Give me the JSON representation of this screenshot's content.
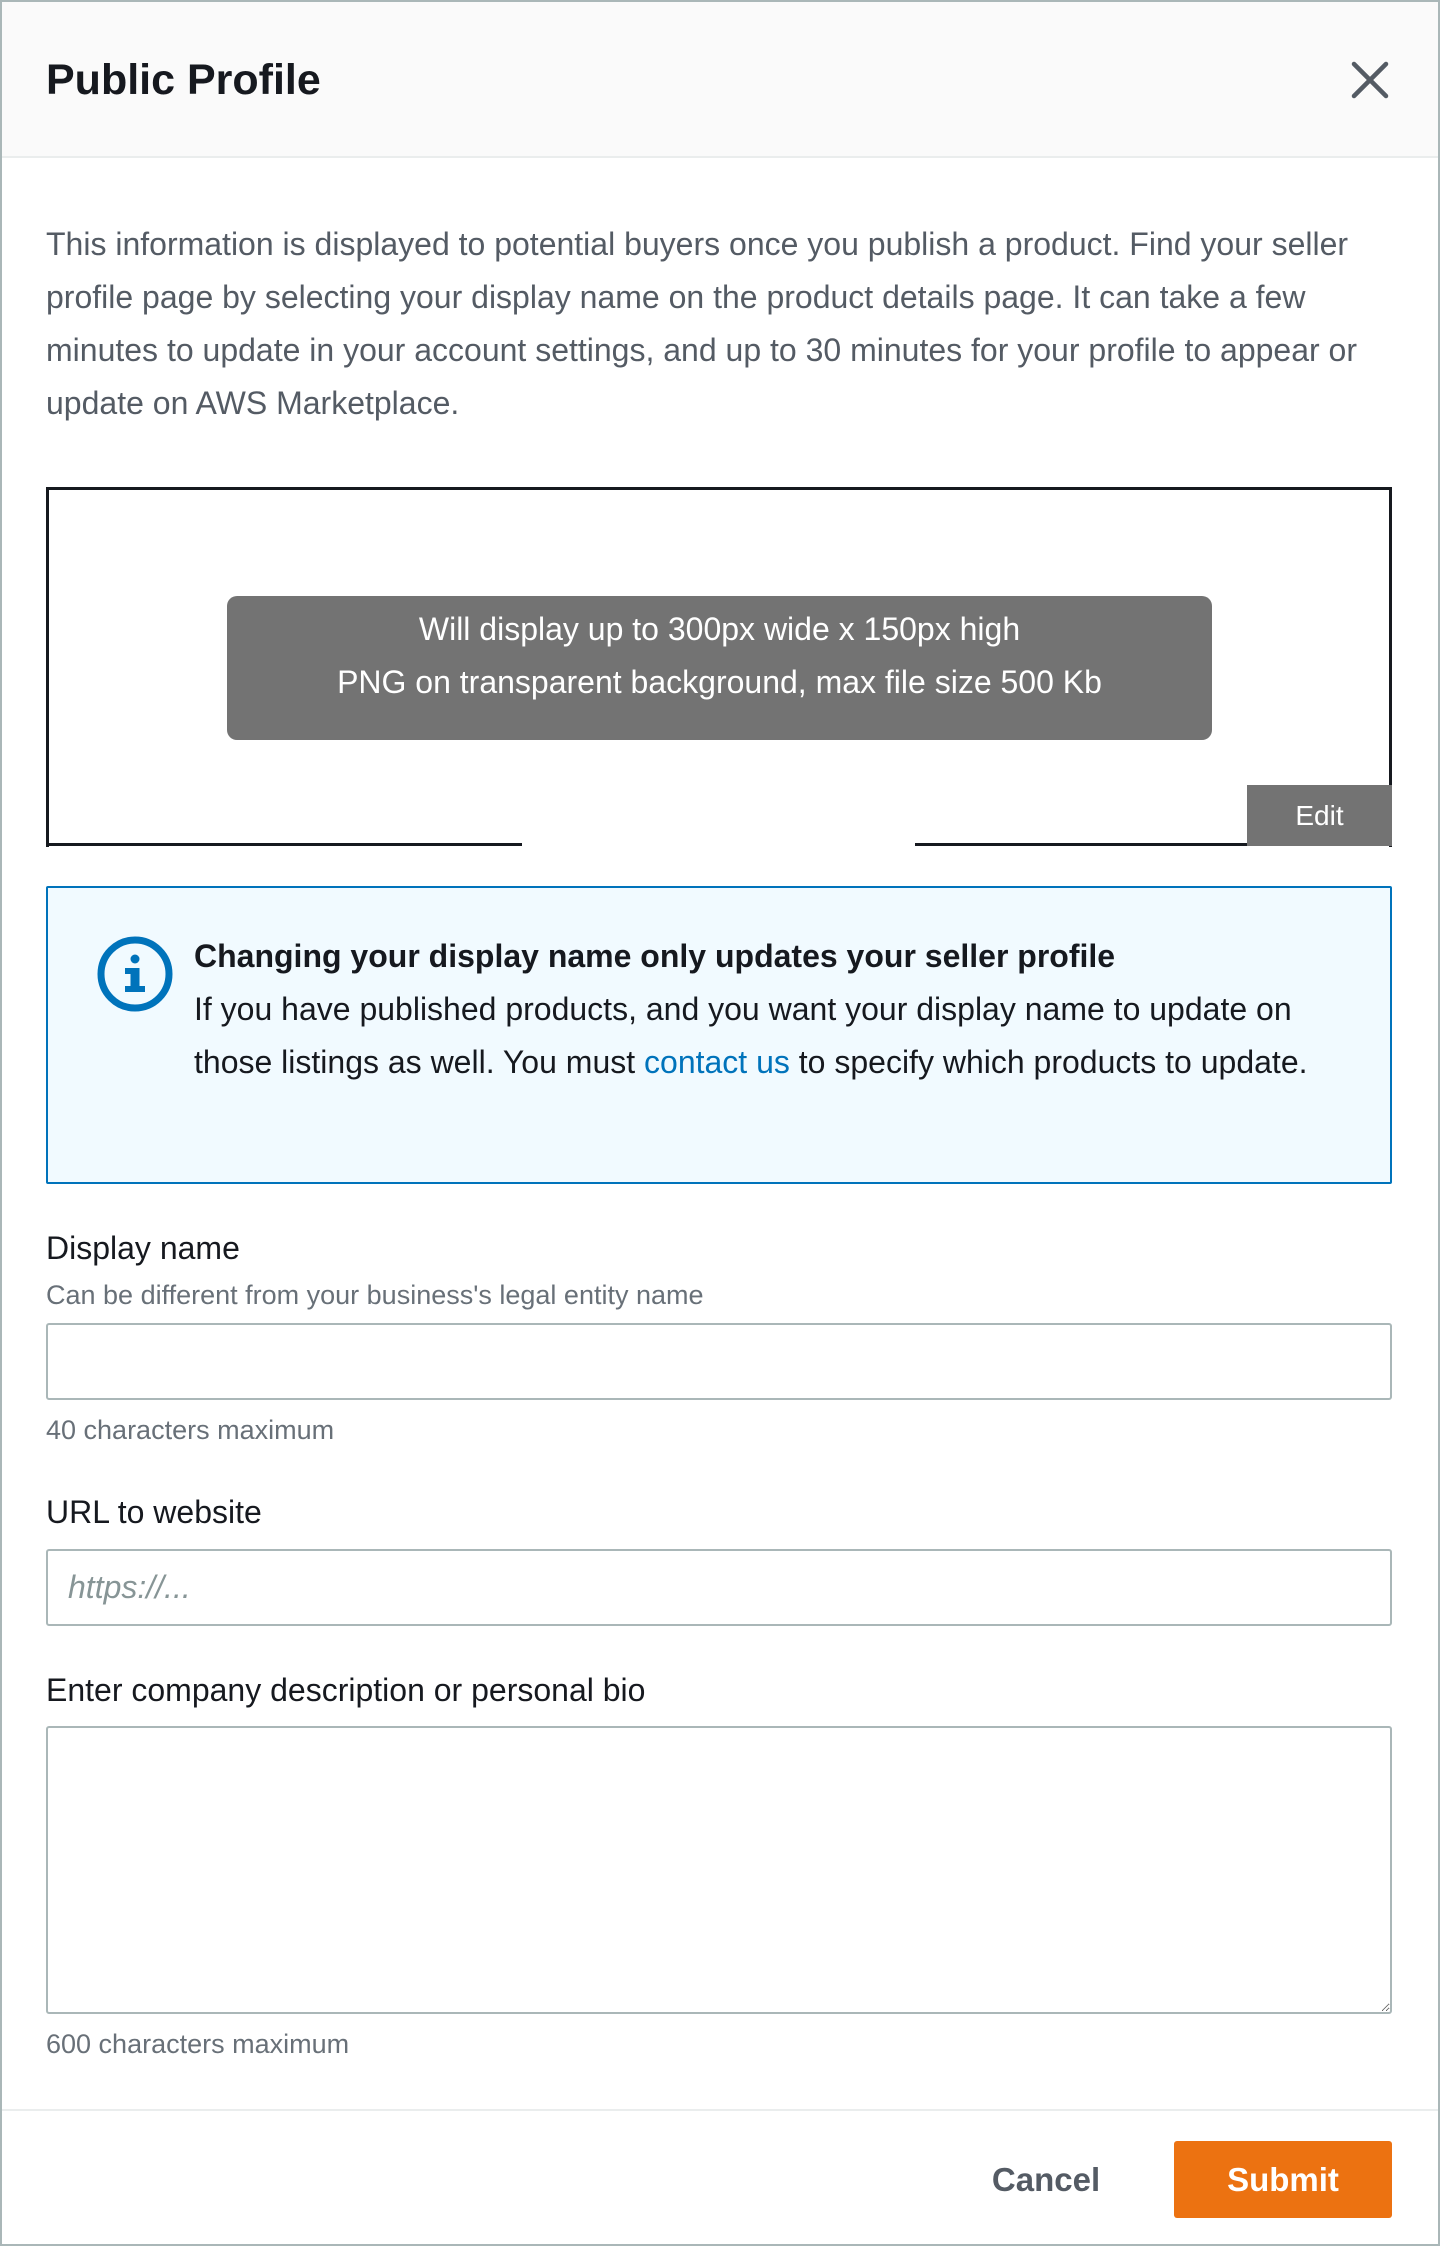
{
  "modal": {
    "title": "Public Profile",
    "close_icon": "close-icon"
  },
  "intro_text": "This information is displayed to potential buyers once you publish a product. Find your seller profile page by selecting your display name on the product details page. It can take a few minutes to update in your account settings, and up to 30 minutes for your profile to appear or update on AWS Marketplace.",
  "logo_upload": {
    "hint_line1": "Will display up to 300px wide x 150px high",
    "hint_line2": "PNG on transparent background, max file size 500 Kb",
    "edit_label": "Edit"
  },
  "info_alert": {
    "icon": "info-icon",
    "title": "Changing your display name only updates your seller profile",
    "body_before_link": "If you have published products, and you want your display name to update on those listings as well. You must ",
    "link_text": "contact us",
    "body_after_link": " to specify which products to update.",
    "color": "#0073bb"
  },
  "form": {
    "display_name": {
      "label": "Display name",
      "description": "Can be different from your business's legal entity name",
      "value": "",
      "constraint": "40 characters maximum"
    },
    "website_url": {
      "label": "URL to website",
      "placeholder": "https://...",
      "value": ""
    },
    "bio": {
      "label": "Enter company description or personal bio",
      "value": "",
      "constraint": "600 characters maximum"
    }
  },
  "footer": {
    "cancel_label": "Cancel",
    "submit_label": "Submit",
    "submit_color": "#ec7211"
  }
}
